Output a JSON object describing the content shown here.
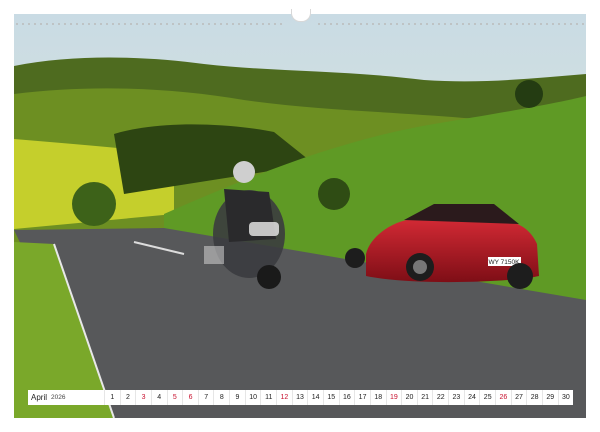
{
  "calendar": {
    "month": "April",
    "year": "2026",
    "days": [
      "1",
      "2",
      "3",
      "4",
      "5",
      "6",
      "7",
      "8",
      "9",
      "10",
      "11",
      "12",
      "13",
      "14",
      "15",
      "16",
      "17",
      "18",
      "19",
      "20",
      "21",
      "22",
      "23",
      "24",
      "25",
      "26",
      "27",
      "28",
      "29",
      "30"
    ],
    "red_days": [
      "3",
      "5",
      "6",
      "12",
      "19",
      "26"
    ]
  },
  "photo": {
    "plate": "WY 7150K"
  }
}
